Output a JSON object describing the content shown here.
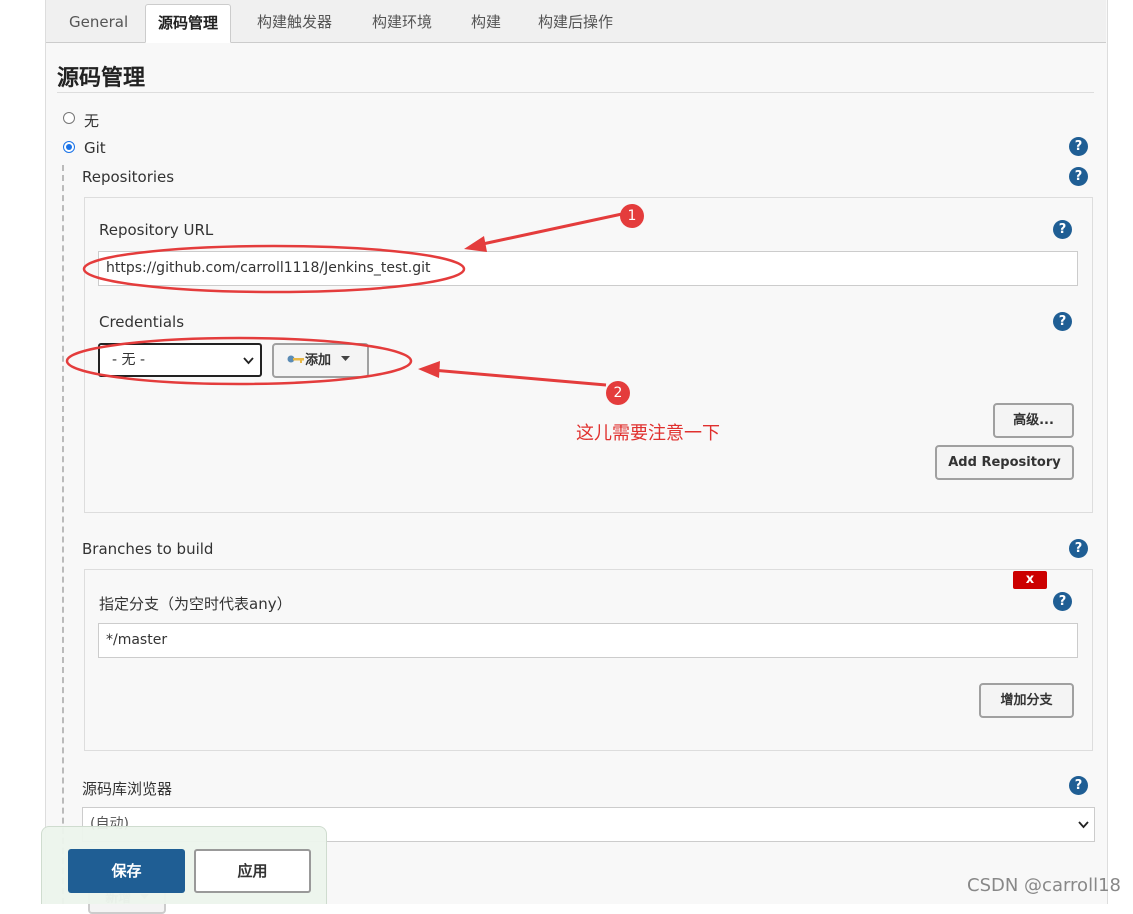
{
  "tabs": [
    {
      "label": "General",
      "active": false
    },
    {
      "label": "源码管理",
      "active": true
    },
    {
      "label": "构建触发器",
      "active": false
    },
    {
      "label": "构建环境",
      "active": false
    },
    {
      "label": "构建",
      "active": false
    },
    {
      "label": "构建后操作",
      "active": false
    }
  ],
  "section_title": "源码管理",
  "scm_options": [
    {
      "label": "无",
      "selected": false
    },
    {
      "label": "Git",
      "selected": true
    }
  ],
  "repositories": {
    "label": "Repositories",
    "url_label": "Repository URL",
    "url_value": "https://github.com/carroll1118/Jenkins_test.git",
    "credentials_label": "Credentials",
    "credentials_value": "- 无 -",
    "add_button_label": "添加",
    "advanced_button_label": "高级...",
    "add_repository_label": "Add Repository"
  },
  "branches": {
    "label": "Branches to build",
    "specifier_label": "指定分支（为空时代表any）",
    "specifier_value": "*/master",
    "delete_label": "x",
    "add_branch_label": "增加分支"
  },
  "browser": {
    "label": "源码库浏览器",
    "value": "(自动)"
  },
  "additional": {
    "add_label": "新增"
  },
  "actions": {
    "save_label": "保存",
    "apply_label": "应用"
  },
  "help_glyph": "?",
  "annotations": {
    "marker1": "1",
    "marker2": "2",
    "note": "这儿需要注意一下",
    "color": "#e0302e"
  },
  "watermark": "CSDN @carroll18",
  "colors": {
    "primary": "#1f5e94",
    "annotation_red": "#e43c3c",
    "delete_red": "#cc0000"
  }
}
